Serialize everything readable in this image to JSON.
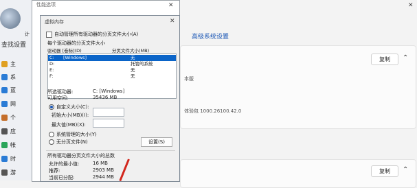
{
  "settings": {
    "sidebar": {
      "title": "查找设置",
      "items": [
        {
          "label": "主",
          "icon": "home-icon",
          "color": "#e0a020"
        },
        {
          "label": "系",
          "icon": "system-icon",
          "color": "#2a7bd5"
        },
        {
          "label": "蓝",
          "icon": "bluetooth-icon",
          "color": "#2a7bd5"
        },
        {
          "label": "网",
          "icon": "network-icon",
          "color": "#2a7bd5"
        },
        {
          "label": "个",
          "icon": "personalize-icon",
          "color": "#c46e2a"
        },
        {
          "label": "应",
          "icon": "apps-icon",
          "color": "#555555"
        },
        {
          "label": "帐",
          "icon": "account-icon",
          "color": "#2aa55a"
        },
        {
          "label": "时",
          "icon": "time-icon",
          "color": "#2a7bd5"
        },
        {
          "label": "游",
          "icon": "gaming-icon",
          "color": "#555555"
        }
      ]
    },
    "right": {
      "link": "高级系统设置",
      "copy_label": "复制",
      "text_version": "本版",
      "text_build": "体验包 1000.26100.42.0"
    }
  },
  "back_dialog": {
    "title": "性能选项",
    "tab_label": "计"
  },
  "dialog": {
    "title": "虚拟内存",
    "auto_manage": "自动管理所有驱动器的分页文件大小(A)",
    "per_drive_label": "每个驱动器的分页文件大小",
    "col_drive": "驱动器 [卷标](D)",
    "col_size": "分页文件大小(MB)",
    "drives": [
      {
        "drive": "C:",
        "label": "[Windows]",
        "size": "无",
        "selected": true
      },
      {
        "drive": "D:",
        "label": "",
        "size": "托管的系统",
        "selected": false
      },
      {
        "drive": "E:",
        "label": "",
        "size": "无",
        "selected": false
      },
      {
        "drive": "F:",
        "label": "",
        "size": "无",
        "selected": false
      }
    ],
    "selected_drive_label": "所选驱动器:",
    "selected_drive_value": "C: [Windows]",
    "available_label": "可用空间:",
    "available_value": "35436 MB",
    "custom_size": "自定义大小(C):",
    "initial_size": "初始大小(MB)(I):",
    "max_size": "最大值(MB)(X):",
    "system_managed": "系统管理的大小(Y)",
    "no_paging": "无分页文件(N)",
    "set_button": "设置(S)",
    "total_label": "所有驱动器分页文件大小的总数",
    "min_allowed_label": "允许的最小值:",
    "min_allowed_value": "16 MB",
    "recommended_label": "推荐:",
    "recommended_value": "2903 MB",
    "current_label": "当前已分配:",
    "current_value": "2944 MB"
  },
  "colors": {
    "accent": "#0a64c8",
    "arrow": "#d2261c"
  }
}
